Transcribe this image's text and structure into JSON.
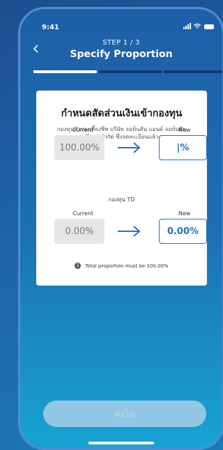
{
  "status_bar": {
    "time": "9:41"
  },
  "header": {
    "step": "STEP 1 / 3",
    "title": "Specify Proportion",
    "back_icon": "chevron-left-icon"
  },
  "progress": {
    "current_step": 1,
    "total_steps": 3
  },
  "card": {
    "title": "กำหนดสัดส่วนเงินเข้ากองทุน",
    "subtitle": "กองทุนสำรองเลี้ยงชีพ บริษัท จอห์นสัน แอนด์ จอห์นสัน (ไทย) จำกัด ซึ่งจดทะเบียนแล้ว",
    "current_label": "Current",
    "new_label": "New",
    "fund1": {
      "current": "100.00%",
      "new": "|%"
    },
    "fund2": {
      "name": "กองทุน TD",
      "current_label": "Current",
      "new_label": "New",
      "current": "0.00%",
      "new": "0.00%"
    },
    "notice": "Total proportion must be 100.00%"
  },
  "footer": {
    "next_label": "ต่อไป"
  },
  "colors": {
    "accent": "#2371c6",
    "progress_active": "#ffffff",
    "button_disabled": "#93c6e3"
  }
}
